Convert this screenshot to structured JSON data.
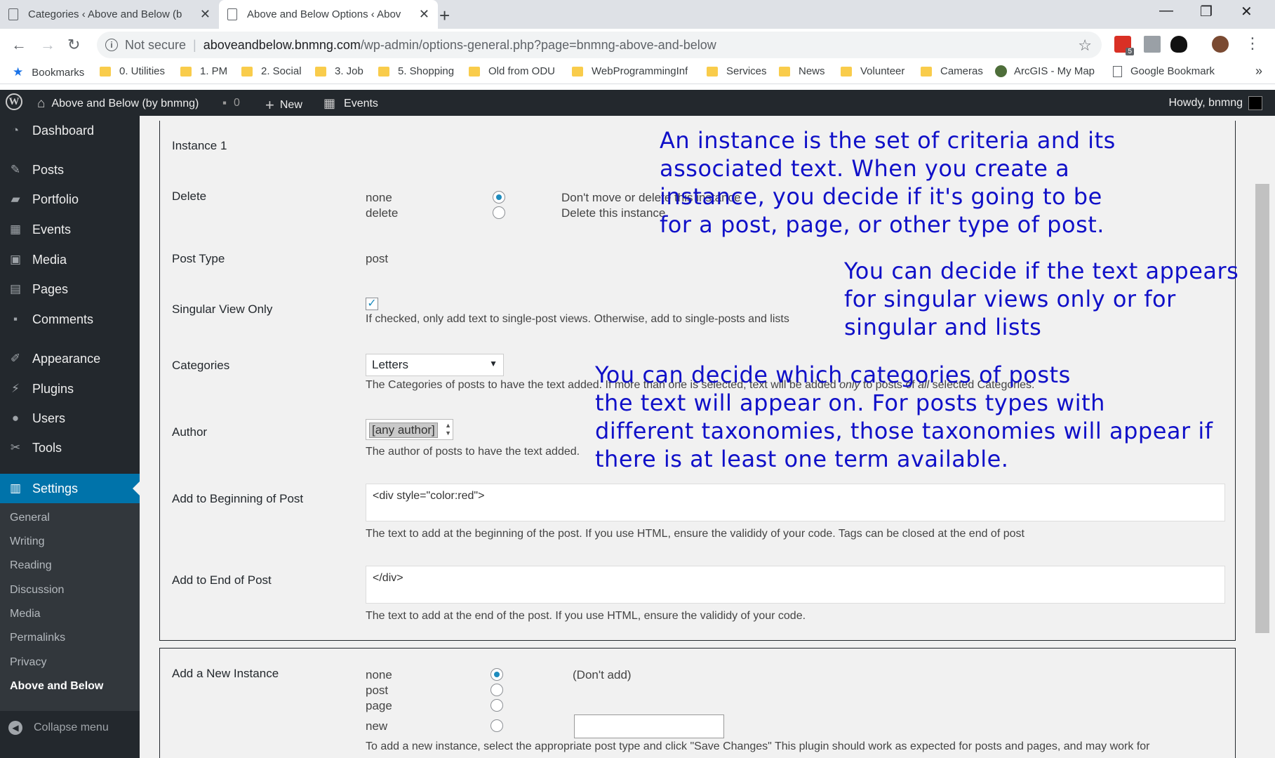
{
  "browser": {
    "tabs": [
      {
        "title": "Categories ‹ Above and Below (b",
        "active": false
      },
      {
        "title": "Above and Below Options ‹ Abov",
        "active": true
      }
    ],
    "not_secure": "Not secure",
    "url_host": "aboveandbelow.bnmng.com",
    "url_path": "/wp-admin/options-general.php?page=bnmng-above-and-below",
    "extension_badge": "5",
    "bookmarks": [
      "Bookmarks",
      "0. Utilities",
      "1. PM",
      "2. Social",
      "3. Job",
      "5. Shopping",
      "Old from ODU",
      "WebProgrammingInf",
      "Services",
      "News",
      "Volunteer",
      "Cameras",
      "ArcGIS - My Map",
      "Google Bookmark"
    ]
  },
  "adminbar": {
    "site_name": "Above and Below (by bnmng)",
    "comments_count": "0",
    "new_label": "New",
    "events_label": "Events",
    "howdy": "Howdy, bnmng"
  },
  "sidebar": {
    "items": [
      "Dashboard",
      "Posts",
      "Portfolio",
      "Events",
      "Media",
      "Pages",
      "Comments",
      "Appearance",
      "Plugins",
      "Users",
      "Tools",
      "Settings"
    ],
    "submenu": [
      "General",
      "Writing",
      "Reading",
      "Discussion",
      "Media",
      "Permalinks",
      "Privacy",
      "Above and Below"
    ],
    "collapse": "Collapse menu"
  },
  "instance": {
    "title": "Instance 1",
    "delete_label": "Delete",
    "delete_options": [
      {
        "value": "none",
        "desc": "Don't move or delete this instance",
        "checked": true
      },
      {
        "value": "delete",
        "desc": "Delete this instance",
        "checked": false
      }
    ],
    "post_type_label": "Post Type",
    "post_type_value": "post",
    "singular_label": "Singular View Only",
    "singular_checked": true,
    "singular_desc": "If checked, only add text to single-post views. Otherwise, add to single-posts and lists",
    "categories_label": "Categories",
    "categories_selected": "Letters",
    "categories_desc_a": "The Categories of posts to have the text added. If more than one is selected, text will be added ",
    "categories_desc_em1": "only",
    "categories_desc_b": " to posts of ",
    "categories_desc_em2": "all",
    "categories_desc_c": " selected Categories.",
    "author_label": "Author",
    "author_selected": "[any author]",
    "author_desc": "The author of posts to have the text added.",
    "begin_label": "Add to Beginning of Post",
    "begin_value": "<div style=\"color:red\">",
    "begin_desc": "The text to add at the beginning of the post. If you use HTML, ensure the valididy of your code. Tags can be closed at the end of post",
    "end_label": "Add to End of Post",
    "end_value": "</div>",
    "end_desc": "The text to add at the end of the post. If you use HTML, ensure the valididy of your code."
  },
  "new_instance": {
    "label": "Add a New Instance",
    "options": [
      {
        "value": "none",
        "checked": true
      },
      {
        "value": "post",
        "checked": false
      },
      {
        "value": "page",
        "checked": false
      },
      {
        "value": "new",
        "checked": false
      }
    ],
    "none_desc": "(Don't add)",
    "help": "To add a new instance, select the appropriate post type and click \"Save Changes\" This plugin should work as expected for posts and pages, and may work for"
  },
  "annotations": {
    "a1": [
      "An instance is the set of criteria and its",
      "associated text.   When you create a",
      "instance, you decide if it's going to be",
      "for a post, page, or other type of post."
    ],
    "a2": [
      "You can decide if the text appears",
      "for singular views only or for",
      "singular and lists"
    ],
    "a3": [
      "You can decide which categories of posts",
      "the text will appear on.  For posts types with",
      "different taxonomies, those taxonomies will appear if",
      "there is at least one term available."
    ]
  }
}
